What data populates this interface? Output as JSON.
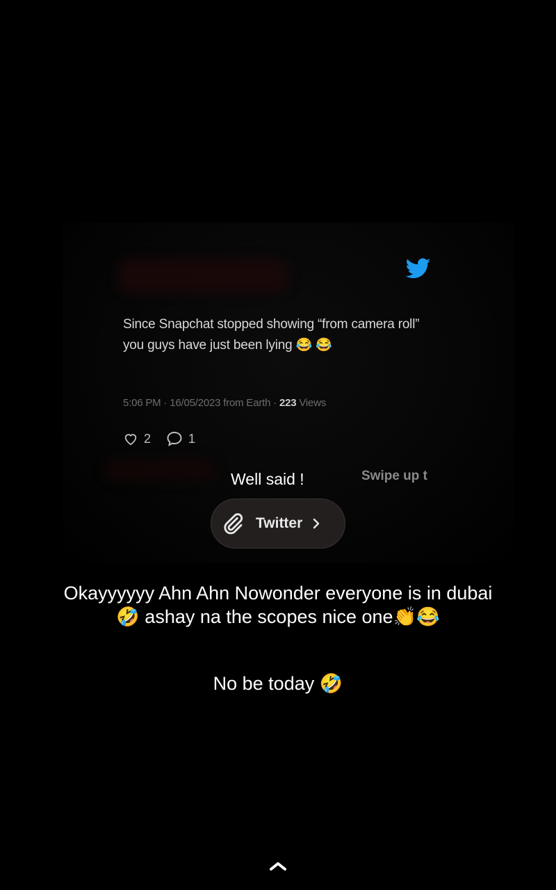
{
  "tweet": {
    "text": "Since Snapchat stopped showing “from camera roll” you guys have just been lying 😂 😂",
    "meta_prefix": "5:06 PM · 16/05/2023 from Earth · ",
    "views_count": "223",
    "views_label": " Views",
    "likes": "2",
    "replies": "1"
  },
  "overlay": {
    "reply_text": "Well said !",
    "swipe_text": "Swipe up t",
    "link_label": "Twitter"
  },
  "captions": {
    "line1": "Okayyyyyy Ahn Ahn Nowonder everyone is in dubai🤣 ashay na the scopes nice one👏😂",
    "line2": "No be today 🤣"
  },
  "colors": {
    "twitter_blue": "#1d9bf0",
    "background": "#000000"
  }
}
